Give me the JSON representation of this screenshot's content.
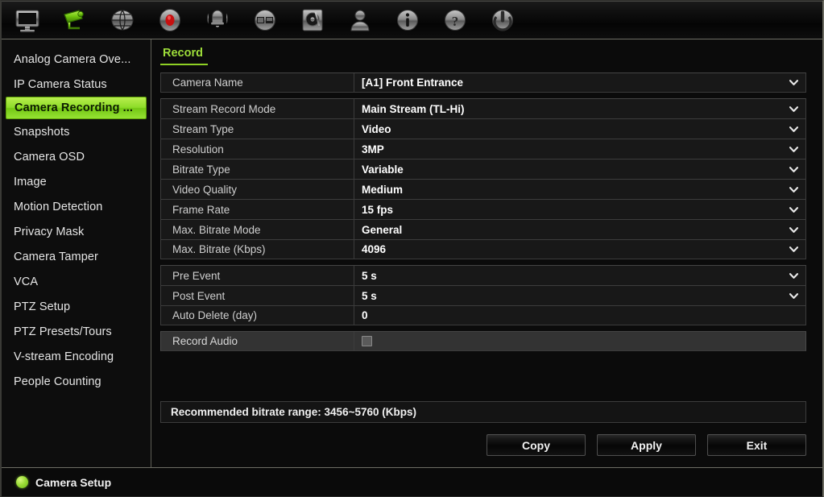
{
  "toolbar": {
    "icons": [
      {
        "name": "monitor-icon",
        "label": "Display",
        "active": false
      },
      {
        "name": "video-camera-icon",
        "label": "Camera Setup",
        "active": true
      },
      {
        "name": "network-icon",
        "label": "Network",
        "active": false
      },
      {
        "name": "record-icon",
        "label": "Recording",
        "active": false
      },
      {
        "name": "alarm-bell-icon",
        "label": "Alarm",
        "active": false
      },
      {
        "name": "video-wall-icon",
        "label": "Video Wall",
        "active": false
      },
      {
        "name": "hard-disk-icon",
        "label": "Storage",
        "active": false
      },
      {
        "name": "user-icon",
        "label": "User Management",
        "active": false
      },
      {
        "name": "info-icon",
        "label": "System Info",
        "active": false
      },
      {
        "name": "help-icon",
        "label": "Help",
        "active": false
      },
      {
        "name": "power-icon",
        "label": "Shutdown",
        "active": false
      }
    ]
  },
  "sidebar": {
    "items": [
      {
        "label": "Analog Camera Ove...",
        "active": false
      },
      {
        "label": "IP Camera Status",
        "active": false
      },
      {
        "label": "Camera Recording ...",
        "active": true
      },
      {
        "label": "Snapshots",
        "active": false
      },
      {
        "label": "Camera OSD",
        "active": false
      },
      {
        "label": "Image",
        "active": false
      },
      {
        "label": "Motion Detection",
        "active": false
      },
      {
        "label": "Privacy Mask",
        "active": false
      },
      {
        "label": "Camera Tamper",
        "active": false
      },
      {
        "label": "VCA",
        "active": false
      },
      {
        "label": "PTZ Setup",
        "active": false
      },
      {
        "label": "PTZ Presets/Tours",
        "active": false
      },
      {
        "label": "V-stream Encoding",
        "active": false
      },
      {
        "label": "People Counting",
        "active": false
      }
    ]
  },
  "tabs": [
    {
      "label": "Record",
      "active": true
    }
  ],
  "form": {
    "groups": [
      {
        "rows": [
          {
            "label": "Camera Name",
            "value": "[A1] Front Entrance",
            "control": "dropdown",
            "disabled": false
          }
        ]
      },
      {
        "rows": [
          {
            "label": "Stream Record Mode",
            "value": "Main Stream (TL-Hi)",
            "control": "dropdown",
            "disabled": false
          },
          {
            "label": "Stream Type",
            "value": "Video",
            "control": "dropdown",
            "disabled": false
          },
          {
            "label": "Resolution",
            "value": "3MP",
            "control": "dropdown",
            "disabled": false
          },
          {
            "label": "Bitrate Type",
            "value": "Variable",
            "control": "dropdown",
            "disabled": false
          },
          {
            "label": "Video Quality",
            "value": "Medium",
            "control": "dropdown",
            "disabled": false
          },
          {
            "label": "Frame Rate",
            "value": "15 fps",
            "control": "dropdown",
            "disabled": false
          },
          {
            "label": "Max. Bitrate Mode",
            "value": "General",
            "control": "dropdown",
            "disabled": false
          },
          {
            "label": "Max. Bitrate (Kbps)",
            "value": "4096",
            "control": "dropdown",
            "disabled": false
          }
        ]
      },
      {
        "rows": [
          {
            "label": "Pre Event",
            "value": "5 s",
            "control": "dropdown",
            "disabled": false
          },
          {
            "label": "Post Event",
            "value": "5 s",
            "control": "dropdown",
            "disabled": false
          },
          {
            "label": "Auto Delete (day)",
            "value": "0",
            "control": "text",
            "disabled": false
          }
        ]
      },
      {
        "rows": [
          {
            "label": "Record Audio",
            "value": "",
            "control": "checkbox",
            "checked": false,
            "disabled": true
          }
        ]
      }
    ]
  },
  "note": {
    "text": "Recommended bitrate range: 3456~5760 (Kbps)"
  },
  "buttons": [
    {
      "label": "Copy",
      "name": "copy-button"
    },
    {
      "label": "Apply",
      "name": "apply-button"
    },
    {
      "label": "Exit",
      "name": "exit-button"
    }
  ],
  "status": {
    "text": "Camera Setup",
    "indicator_color": "#9ede3a"
  },
  "colors": {
    "accent_green": "#8ed024",
    "highlight_green": "#8ddc28",
    "panel_bg": "#0b0b0b",
    "row_bg": "#181818",
    "row_disabled_bg": "#333333"
  }
}
